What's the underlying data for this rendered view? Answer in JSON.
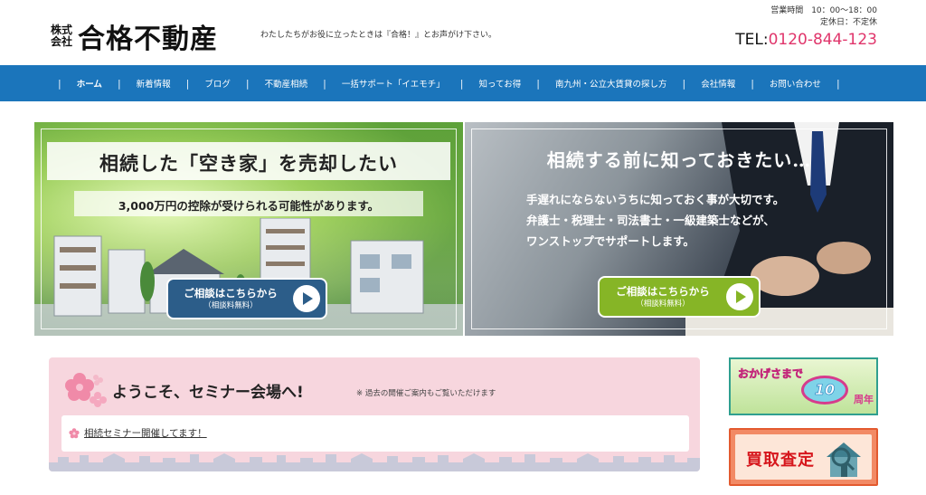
{
  "header": {
    "logo_kabu_top": "株式",
    "logo_kabu_bottom": "会社",
    "logo_name": "合格不動産",
    "tagline": "わたしたちがお役に立ったときは『合格！』とお声がけ下さい。",
    "hours": "営業時間　10：00〜18：00",
    "holiday": "定休日：不定休",
    "tel_label": "TEL:",
    "tel_number": "0120-844-123"
  },
  "nav": {
    "items": [
      {
        "label": "ホーム"
      },
      {
        "label": "新着情報"
      },
      {
        "label": "ブログ"
      },
      {
        "label": "不動産相続"
      },
      {
        "label": "一括サポート「イエモチ」"
      },
      {
        "label": "知ってお得"
      },
      {
        "label": "南九州・公立大賃貸の探し方"
      },
      {
        "label": "会社情報"
      },
      {
        "label": "お問い合わせ"
      }
    ],
    "separator": "|"
  },
  "banner_left": {
    "title": "相続した「空き家」を売却したい",
    "subtitle": "3,000万円の控除が受けられる可能性があります。",
    "cta_main": "ご相談はこちらから",
    "cta_sub": "（相談料無料）"
  },
  "banner_right": {
    "title": "相続する前に知っておきたい…",
    "line1": "手遅れにならないうちに知っておく事が大切です。",
    "line2": "弁護士・税理士・司法書士・一級建築士などが、",
    "line3": "ワンストップでサポートします。",
    "cta_main": "ご相談はこちらから",
    "cta_sub": "（相談料無料）"
  },
  "seminar": {
    "heading": "ようこそ、セミナー会場へ!",
    "note": "※ 過去の開催ご案内もご覧いただけます",
    "items": [
      {
        "label": "相続セミナー開催してます！"
      }
    ]
  },
  "side": {
    "anniv_text": "おかげさまで",
    "anniv_number": "10",
    "anniv_unit": "周年",
    "appraisal_text": "買取査定"
  },
  "colors": {
    "nav_bg": "#1b75bb",
    "tel": "#e0356b",
    "cta_left": "#2c5d89",
    "cta_right": "#86b526",
    "seminar_bg": "#f7d6de"
  }
}
